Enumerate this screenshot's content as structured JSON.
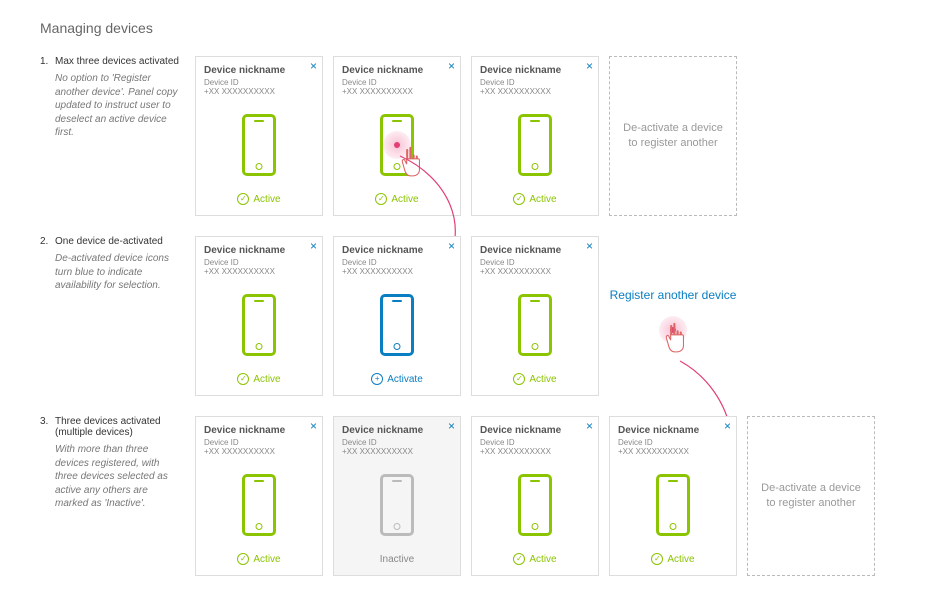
{
  "page_title": "Managing devices",
  "common": {
    "nick": "Device nickname",
    "id_label": "Device ID",
    "id_value": "+XX XXXXXXXXXX",
    "status_active": "Active",
    "status_activate": "Activate",
    "status_inactive": "Inactive",
    "deactivate_msg": "De-activate a device to register another",
    "register_msg": "Register another device"
  },
  "scenarios": [
    {
      "num": "1.",
      "title": "Max three devices activated",
      "note": "No option to 'Register another device'. Panel copy updated to instruct user to deselect an active device first."
    },
    {
      "num": "2.",
      "title": "One device de-activated",
      "note": "De-activated device icons turn blue to indicate availability for selection."
    },
    {
      "num": "3.",
      "title": "Three devices activated (multiple devices)",
      "note": "With more than three devices registered, with three devices selected as active any others are marked as 'Inactive'."
    }
  ]
}
